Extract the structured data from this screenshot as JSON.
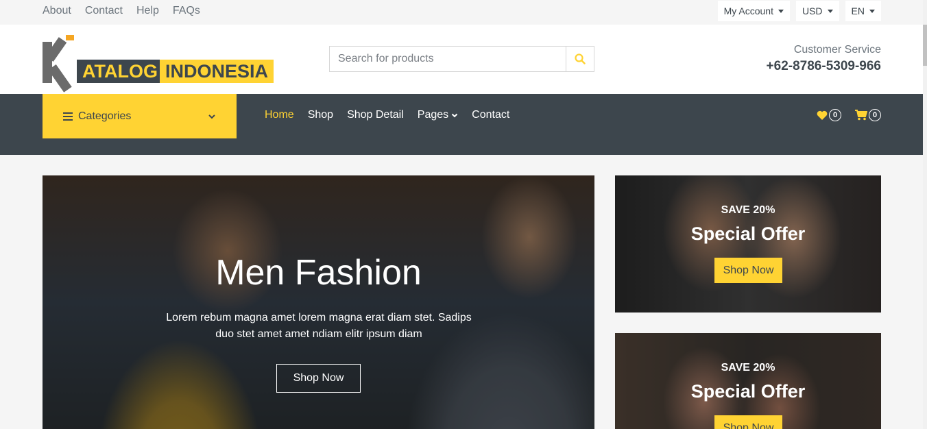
{
  "topbar": {
    "links": [
      "About",
      "Contact",
      "Help",
      "FAQs"
    ],
    "my_account": "My Account",
    "currency": "USD",
    "language": "EN"
  },
  "header": {
    "logo_word1": "ATALOG",
    "logo_word2": "INDONESIA",
    "search_placeholder": "Search for products",
    "cs_label": "Customer Service",
    "cs_phone": "+62-8786-5309-966"
  },
  "nav": {
    "categories_label": "Categories",
    "menu": [
      "Home",
      "Shop",
      "Shop Detail",
      "Pages",
      "Contact"
    ],
    "wishlist_count": "0",
    "cart_count": "0"
  },
  "hero": {
    "title": "Men Fashion",
    "description": "Lorem rebum magna amet lorem magna erat diam stet. Sadips duo stet amet amet ndiam elitr ipsum diam",
    "button": "Shop Now"
  },
  "offers": [
    {
      "save": "SAVE 20%",
      "title": "Special Offer",
      "button": "Shop Now"
    },
    {
      "save": "SAVE 20%",
      "title": "Special Offer",
      "button": "Shop Now"
    }
  ],
  "colors": {
    "accent": "#ffd333",
    "dark": "#3d464d",
    "muted": "#6c757d"
  }
}
